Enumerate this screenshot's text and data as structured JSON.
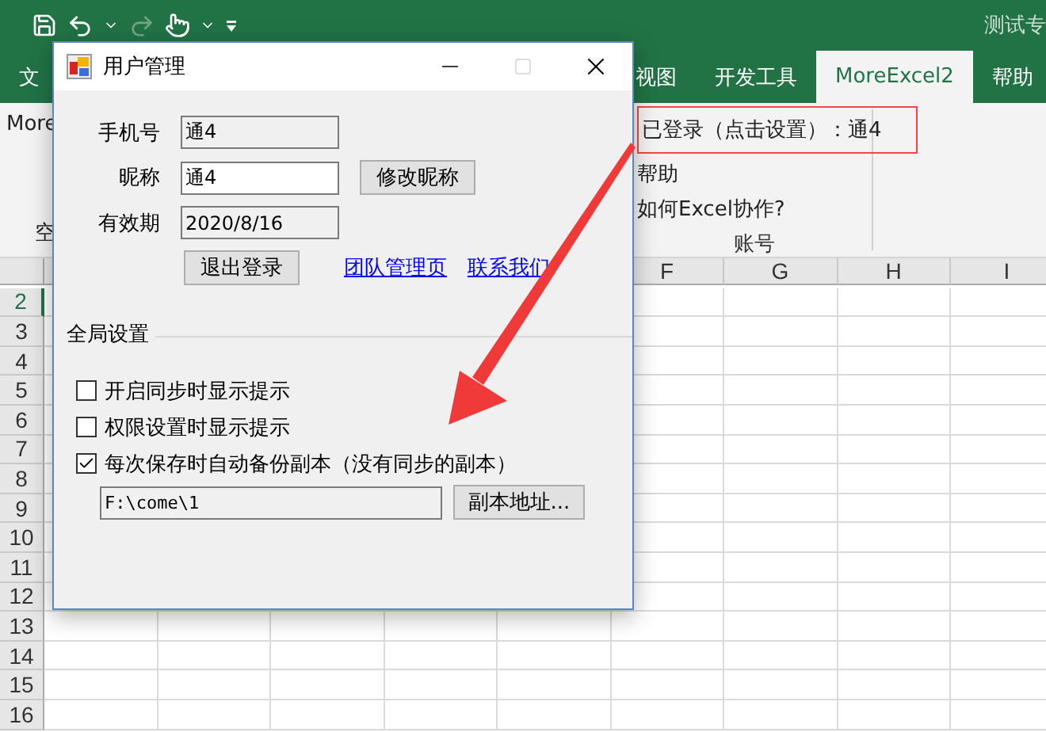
{
  "app": {
    "title": "测试专"
  },
  "ribbon_tabs": [
    {
      "label": "文",
      "selected": false
    },
    {
      "label": "视图",
      "selected": false
    },
    {
      "label": "开发工具",
      "selected": false
    },
    {
      "label": "MoreExcel2",
      "selected": true
    },
    {
      "label": "帮助",
      "selected": false
    }
  ],
  "ribbon": {
    "left_label": "More",
    "left_group": "空",
    "account": {
      "login": "已登录（点击设置）：通4",
      "help": "帮助",
      "collab": "如何Excel协作?",
      "group": "账号"
    }
  },
  "sheet": {
    "columns": [
      "F",
      "G",
      "H",
      "I"
    ],
    "rows": [
      "2",
      "3",
      "4",
      "5",
      "6",
      "7",
      "8",
      "9",
      "10",
      "11",
      "12",
      "13",
      "14",
      "15",
      "16"
    ]
  },
  "dialog": {
    "title": "用户管理",
    "phone": {
      "label": "手机号",
      "value": "通4"
    },
    "nickname": {
      "label": "昵称",
      "value": "通4",
      "button": "修改昵称"
    },
    "expiry": {
      "label": "有效期",
      "value": "2020/8/16"
    },
    "logout": "退出登录",
    "links": [
      "团队管理页",
      "联系我们"
    ],
    "group": "全局设置",
    "options": [
      {
        "label": "开启同步时显示提示",
        "checked": false
      },
      {
        "label": "权限设置时显示提示",
        "checked": false
      },
      {
        "label": "每次保存时自动备份副本（没有同步的副本）",
        "checked": true
      }
    ],
    "path": {
      "value": "F:\\come\\1",
      "button": "副本地址..."
    }
  }
}
